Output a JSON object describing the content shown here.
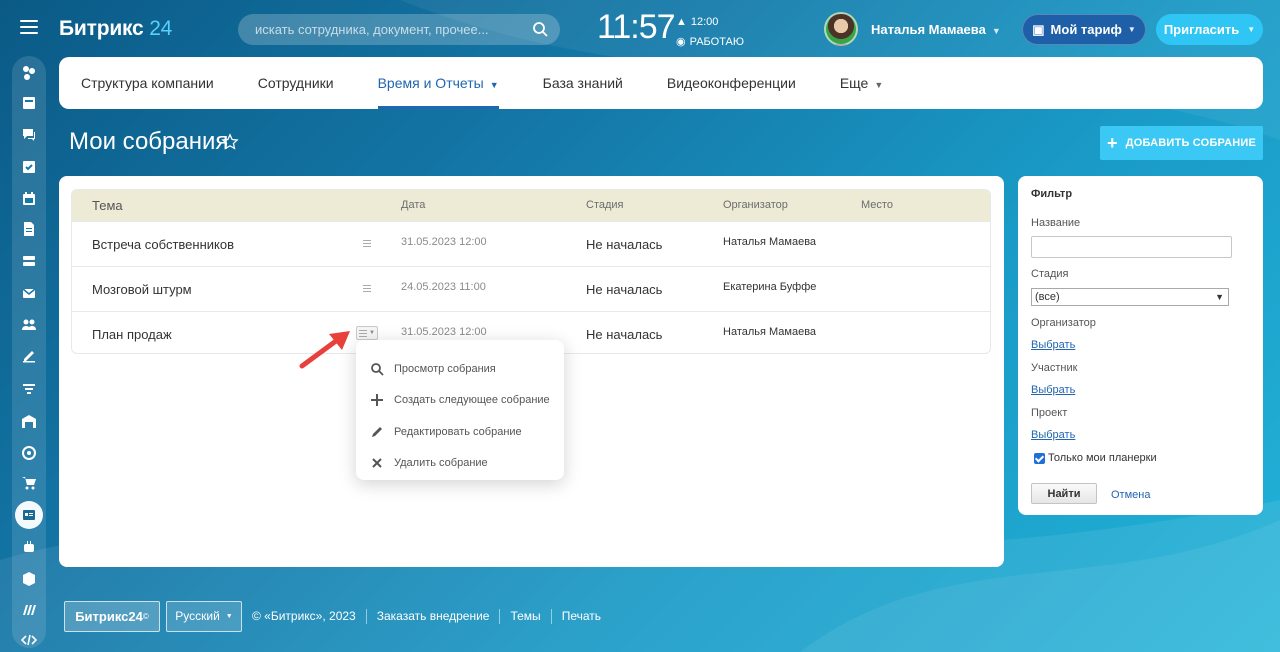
{
  "app": {
    "logo_main": "Битрикс",
    "logo_num": "24"
  },
  "search": {
    "placeholder": "искать сотрудника, документ, прочее..."
  },
  "clock": {
    "time": "11:57",
    "alarm": "12:00",
    "status": "РАБОТАЮ"
  },
  "user": {
    "name": "Наталья Мамаева"
  },
  "header_buttons": {
    "tariff": "Мой тариф",
    "invite": "Пригласить"
  },
  "tabs": [
    {
      "label": "Структура компании"
    },
    {
      "label": "Сотрудники"
    },
    {
      "label": "Время и Отчеты",
      "active": true
    },
    {
      "label": "База знаний"
    },
    {
      "label": "Видеоконференции"
    },
    {
      "label": "Еще"
    }
  ],
  "page": {
    "title": "Мои собрания",
    "add_button": "ДОБАВИТЬ СОБРАНИЕ"
  },
  "grid": {
    "columns": {
      "topic": "Тема",
      "date": "Дата",
      "stage": "Стадия",
      "organizer": "Организатор",
      "place": "Место"
    },
    "rows": [
      {
        "topic": "Встреча собственников",
        "date": "31.05.2023 12:00",
        "stage": "Не началась",
        "organizer": "Наталья Мамаева"
      },
      {
        "topic": "Мозговой штурм",
        "date": "24.05.2023 11:00",
        "stage": "Не началась",
        "organizer": "Екатерина Буффе"
      },
      {
        "topic": "План продаж",
        "date": "31.05.2023 12:00",
        "stage": "Не началась",
        "organizer": "Наталья Мамаева"
      }
    ]
  },
  "context_menu": {
    "items": [
      {
        "label": "Просмотр собрания",
        "icon": "search-icon"
      },
      {
        "label": "Создать следующее собрание",
        "icon": "plus-icon"
      },
      {
        "label": "Редактировать собрание",
        "icon": "pencil-icon"
      },
      {
        "label": "Удалить собрание",
        "icon": "close-icon"
      }
    ]
  },
  "filter": {
    "title": "Фильтр",
    "name_label": "Название",
    "stage_label": "Стадия",
    "stage_value": "(все)",
    "organizer_label": "Организатор",
    "participant_label": "Участник",
    "project_label": "Проект",
    "choose": "Выбрать",
    "only_mine": "Только мои планерки",
    "find": "Найти",
    "cancel": "Отмена"
  },
  "footer": {
    "logo": "Битрикс24",
    "logo_mark": "©",
    "language": "Русский",
    "copyright": "© «Битрикс», 2023",
    "order": "Заказать внедрение",
    "themes": "Темы",
    "print": "Печать"
  },
  "colors": {
    "accent": "#2066b0",
    "invite": "#2fc6f6",
    "add": "#3bc8f5",
    "tariff": "#1f5fa8",
    "grid_head": "#edead6",
    "arrow": "#e8413b"
  }
}
